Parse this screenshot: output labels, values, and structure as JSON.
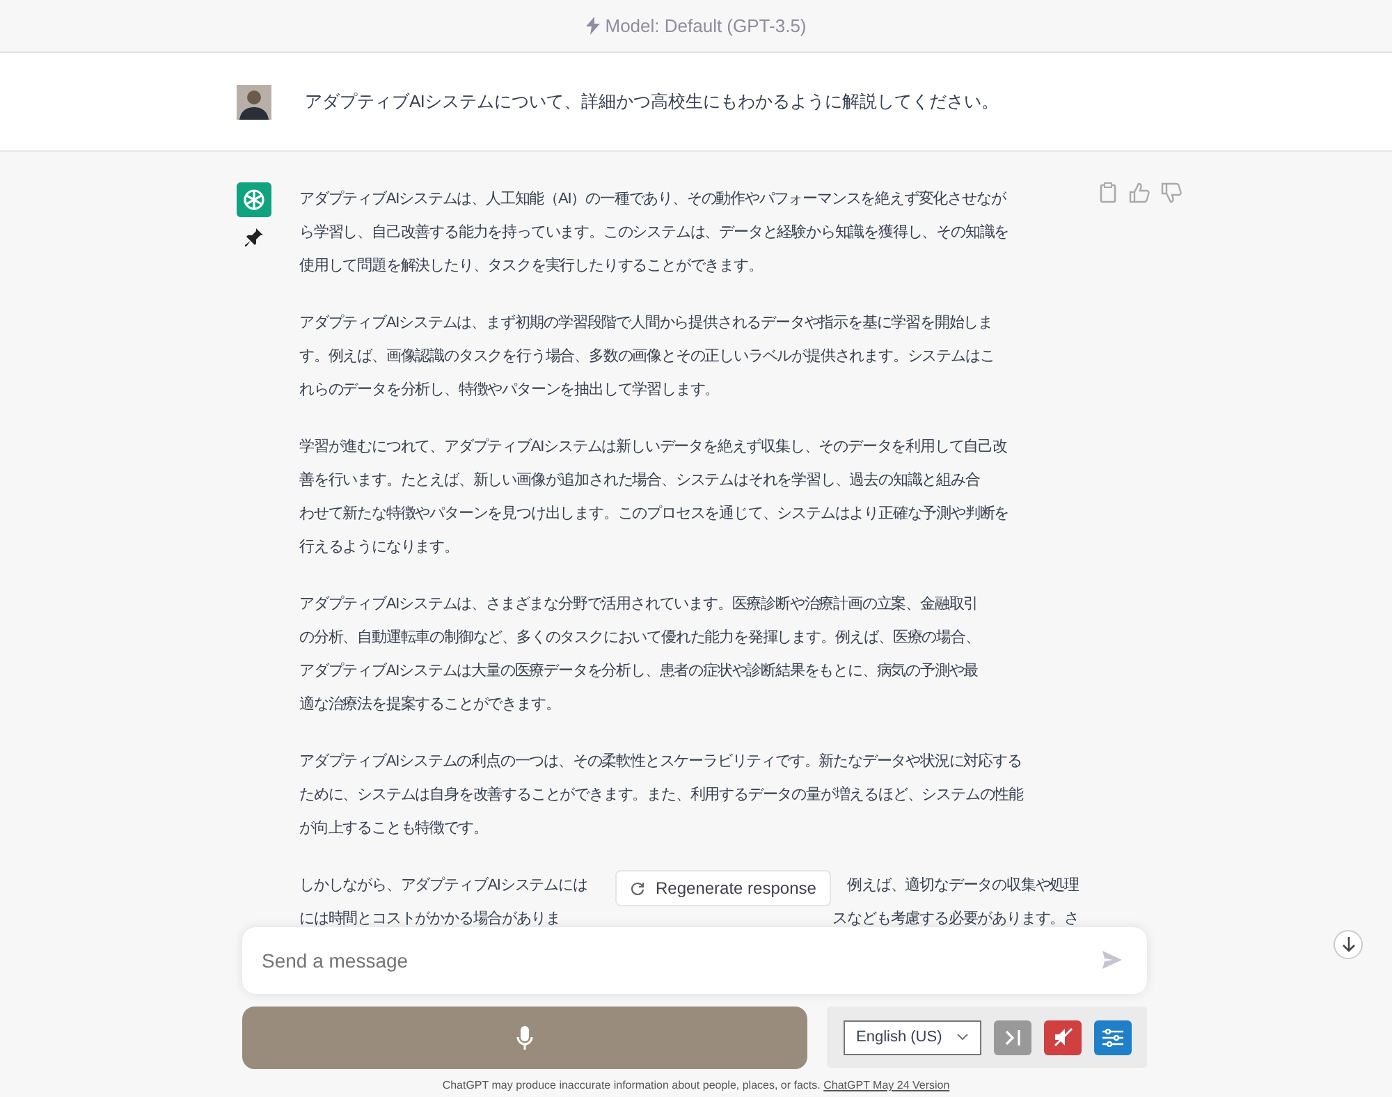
{
  "header": {
    "model_label": "Model: Default (GPT-3.5)"
  },
  "user_message": {
    "text": "アダプティブAIシステムについて、詳細かつ高校生にもわかるように解説してください。"
  },
  "assistant_message": {
    "paragraphs": [
      {
        "lines": [
          "アダプティブAIシステムは、人工知能（AI）の一種であり、その動作やパフォーマンスを絶えず変化させなが",
          "ら学習し、自己改善する能力を持っています。このシステムは、データと経験から知識を獲得し、その知識を",
          "使用して問題を解決したり、タスクを実行したりすることができます。"
        ]
      },
      {
        "lines": [
          "アダプティブAIシステムは、まず初期の学習段階で人間から提供されるデータや指示を基に学習を開始しま",
          "す。例えば、画像認識のタスクを行う場合、多数の画像とその正しいラベルが提供されます。システムはこ",
          "れらのデータを分析し、特徴やパターンを抽出して学習します。"
        ]
      },
      {
        "lines": [
          "学習が進むにつれて、アダプティブAIシステムは新しいデータを絶えず収集し、そのデータを利用して自己改",
          "善を行います。たとえば、新しい画像が追加された場合、システムはそれを学習し、過去の知識と組み合",
          "わせて新たな特徴やパターンを見つけ出します。このプロセスを通じて、システムはより正確な予測や判断を",
          "行えるようになります。"
        ]
      },
      {
        "lines": [
          "アダプティブAIシステムは、さまざまな分野で活用されています。医療診断や治療計画の立案、金融取引",
          "の分析、自動運転車の制御など、多くのタスクにおいて優れた能力を発揮します。例えば、医療の場合、",
          "アダプティブAIシステムは大量の医療データを分析し、患者の症状や診断結果をもとに、病気の予測や最",
          "適な治療法を提案することができます。"
        ]
      },
      {
        "lines": [
          "アダプティブAIシステムの利点の一つは、その柔軟性とスケーラビリティです。新たなデータや状況に対応する",
          "ために、システムは自身を改善することができます。また、利用するデータの量が増えるほど、システムの性能",
          "が向上することも特徴です。"
        ]
      }
    ],
    "covered_paragraph": {
      "lines": [
        {
          "start": "しかしながら、アダプティブAIシステムには",
          "end": "例えば、適切なデータの収集や処理"
        },
        {
          "start": "には時間とコストがかかる場合がありま",
          "end": "スなども考慮する必要があります。さ"
        }
      ]
    }
  },
  "regenerate_button": {
    "label": "Regenerate response"
  },
  "composer": {
    "placeholder": "Send a message"
  },
  "voice_panel": {
    "language": "English (US)",
    "muted": true
  },
  "footer": {
    "text": "ChatGPT may produce inaccurate information about people, places, or facts.",
    "link": "ChatGPT May 24 Version"
  }
}
